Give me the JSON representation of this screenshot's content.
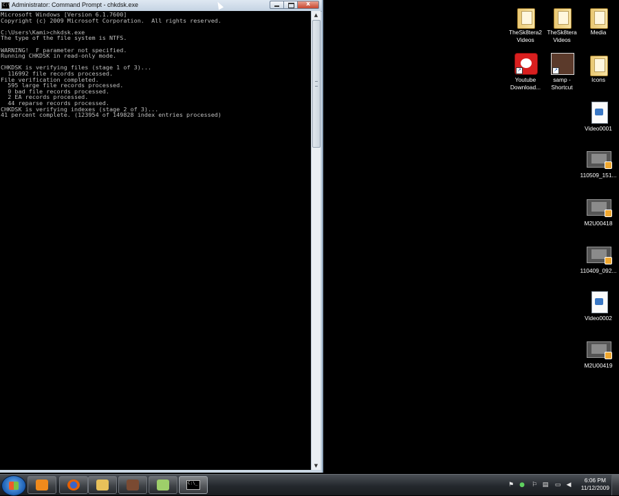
{
  "window": {
    "title": "Administrator: Command Prompt - chkdsk.exe",
    "icon": "cmd-icon",
    "buttons": [
      "minimize-icon",
      "maximize-icon",
      "close-icon"
    ]
  },
  "console": {
    "lines": [
      "Microsoft Windows [Version 6.1.7600]",
      "Copyright (c) 2009 Microsoft Corporation.  All rights reserved.",
      "",
      "C:\\Users\\Kami>chkdsk.exe",
      "The type of the file system is NTFS.",
      "",
      "WARNING!  F parameter not specified.",
      "Running CHKDSK in read-only mode.",
      "",
      "CHKDSK is verifying files (stage 1 of 3)...",
      "  116992 file records processed.",
      "File verification completed.",
      "  595 large file records processed.",
      "  0 bad file records processed.",
      "  2 EA records processed.",
      "  44 reparse records processed.",
      "CHKDSK is verifying indexes (stage 2 of 3)...",
      "41 percent complete. (123954 of 149828 index entries processed)"
    ],
    "background": "#000000",
    "text_color": "#c0c0c0"
  },
  "desktop_icons": [
    {
      "label": "TheSk8tera2 Videos",
      "line1": "TheSk8tera2",
      "line2": "Videos",
      "icon": "folder-icon"
    },
    {
      "label": "TheSk8tera Videos",
      "line1": "TheSk8tera",
      "line2": "Videos",
      "icon": "folder-icon"
    },
    {
      "label": "Media",
      "line1": "Media",
      "line2": "",
      "icon": "folder-icon"
    },
    {
      "label": "Youtube Download...",
      "line1": "Youtube",
      "line2": "Download...",
      "icon": "youtube-downloader-shortcut-icon"
    },
    {
      "label": "samp - Shortcut",
      "line1": "samp -",
      "line2": "Shortcut",
      "icon": "samp-shortcut-icon"
    },
    {
      "label": "Icons",
      "line1": "Icons",
      "line2": "",
      "icon": "folder-icon"
    },
    {
      "label": "Video0001",
      "line1": "Video0001",
      "line2": "",
      "icon": "video-file-icon"
    },
    {
      "label": "110509_151...",
      "line1": "110509_151...",
      "line2": "",
      "icon": "video-thumbnail-icon"
    },
    {
      "label": "M2U00418",
      "line1": "M2U00418",
      "line2": "",
      "icon": "video-thumbnail-icon"
    },
    {
      "label": "110409_092...",
      "line1": "110409_092...",
      "line2": "",
      "icon": "video-thumbnail-icon"
    },
    {
      "label": "Video0002",
      "line1": "Video0002",
      "line2": "",
      "icon": "video-file-icon"
    },
    {
      "label": "M2U00419",
      "line1": "M2U00419",
      "line2": "",
      "icon": "video-thumbnail-icon"
    }
  ],
  "taskbar": {
    "start": "windows-start-icon",
    "pinned": [
      {
        "name": "media-player-icon",
        "color": "#f08a1c"
      },
      {
        "name": "firefox-icon",
        "color": "#e66000"
      },
      {
        "name": "explorer-folder-icon",
        "color": "#e9c15a"
      },
      {
        "name": "samp-app-icon",
        "color": "#7a4a32"
      },
      {
        "name": "notes-app-icon",
        "color": "#9ecf6a"
      },
      {
        "name": "command-prompt-icon",
        "color": "#000000"
      }
    ],
    "tray_icons": [
      "network-flag-icon",
      "green-status-icon",
      "flag-icon",
      "network-icon",
      "monitor-icon",
      "volume-icon"
    ],
    "clock": {
      "time": "6:06 PM",
      "date": "11/12/2009"
    }
  }
}
